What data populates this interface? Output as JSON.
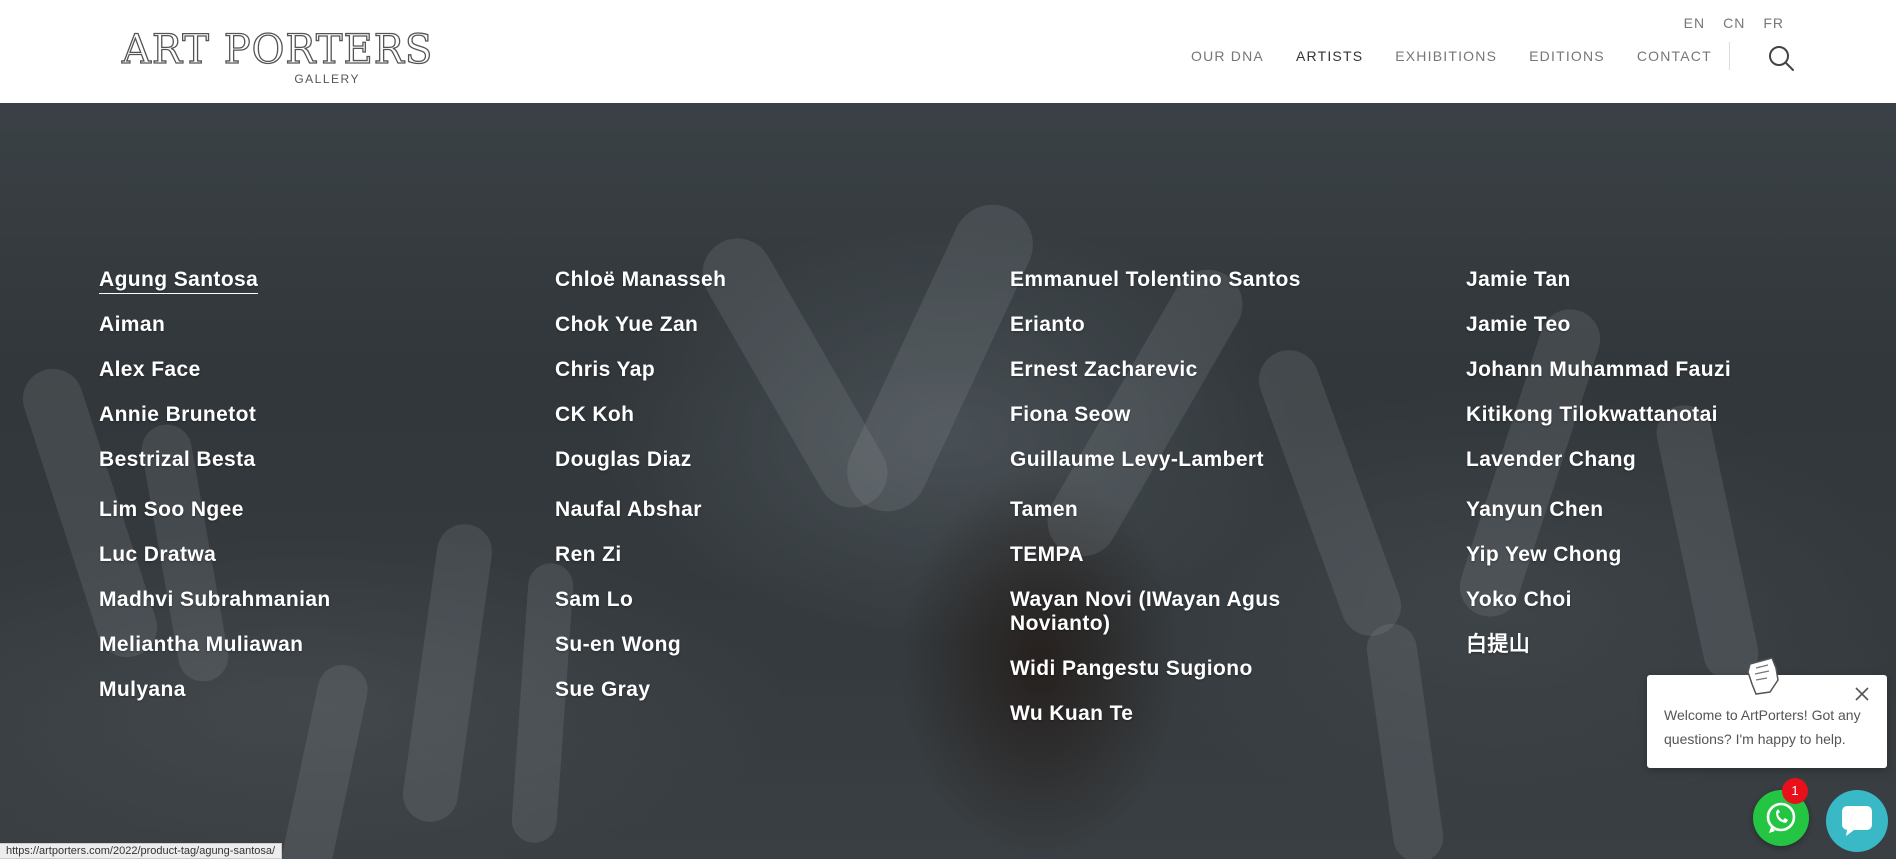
{
  "logo": {
    "title": "ART PORTERS",
    "subtitle": "GALLERY"
  },
  "languages": [
    "EN",
    "CN",
    "FR"
  ],
  "nav": [
    {
      "label": "OUR DNA"
    },
    {
      "label": "ARTISTS",
      "active": true
    },
    {
      "label": "EXHIBITIONS"
    },
    {
      "label": "EDITIONS"
    },
    {
      "label": "CONTACT"
    }
  ],
  "artists": {
    "col1": [
      "Agung Santosa",
      "Aiman",
      "Alex Face",
      "Annie Brunetot",
      "Bestrizal Besta",
      "Lim Soo Ngee",
      "Luc Dratwa",
      "Madhvi Subrahmanian",
      "Meliantha Muliawan",
      "Mulyana"
    ],
    "col2": [
      "Chloë Manasseh",
      "Chok Yue Zan",
      "Chris Yap",
      "CK Koh",
      "Douglas Diaz",
      "Naufal Abshar",
      "Ren Zi",
      "Sam Lo",
      "Su-en Wong",
      "Sue Gray"
    ],
    "col3": [
      "Emmanuel Tolentino Santos",
      "Erianto",
      "Ernest Zacharevic",
      "Fiona Seow",
      "Guillaume Levy-Lambert",
      "Tamen",
      "TEMPA",
      "Wayan Novi (IWayan Agus Novianto)",
      "Widi Pangestu Sugiono",
      "Wu Kuan Te"
    ],
    "col4": [
      "Jamie Tan",
      "Jamie Teo",
      "Johann Muhammad Fauzi",
      "Kitikong Tilokwattanotai",
      "Lavender Chang",
      "Yanyun Chen",
      "Yip Yew Chong",
      "Yoko Choi",
      "白提山"
    ]
  },
  "chat": {
    "message": "Welcome to ArtPorters! Got any questions? I'm happy to help.",
    "badge_count": "1"
  },
  "status_bar": {
    "url": "https://artporters.com/2022/product-tag/agung-santosa/"
  },
  "colors": {
    "whatsapp": "#25c544",
    "messenger": "#39b8c5",
    "badge": "#e8101a"
  }
}
